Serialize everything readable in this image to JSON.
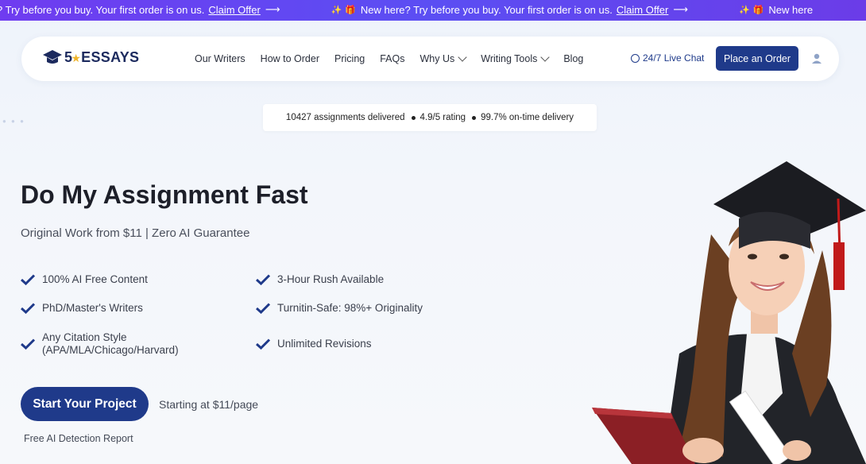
{
  "promo": {
    "items": [
      {
        "text": "? Try before you buy. Your first order is on us.",
        "link": "Claim Offer",
        "arrow": "⟶"
      },
      {
        "text": "New here? Try before you buy. Your first order is on us.",
        "link": "Claim Offer",
        "arrow": "⟶"
      },
      {
        "text": "New here",
        "link": "",
        "arrow": ""
      }
    ]
  },
  "nav": {
    "logo": {
      "five": "5",
      "word": "ESSAYS"
    },
    "links": [
      "Our Writers",
      "How to Order",
      "Pricing",
      "FAQs",
      "Why Us",
      "Writing Tools",
      "Blog"
    ],
    "chat": "24/7 Live Chat",
    "order_button": "Place an Order"
  },
  "stats": {
    "delivered": "10427 assignments delivered",
    "rating": "4.9/5 rating",
    "ontime": "99.7% on-time delivery"
  },
  "hero": {
    "title": "Do My Assignment Fast",
    "subtitle": "Original Work from $11 | Zero AI Guarantee",
    "features": [
      "100% AI Free Content",
      "3-Hour Rush Available",
      "PhD/Master's Writers",
      "Turnitin-Safe: 98%+ Originality",
      "Any Citation Style\n(APA/MLA/Chicago/Harvard)",
      "Unlimited Revisions"
    ],
    "cta": "Start Your Project",
    "cta_note": "Starting at $11/page",
    "free_ai": "Free AI Detection Report"
  },
  "colors": {
    "brand": "#1f3a8a",
    "promo": "#6f3cf0",
    "check": "#1f3a8a"
  }
}
